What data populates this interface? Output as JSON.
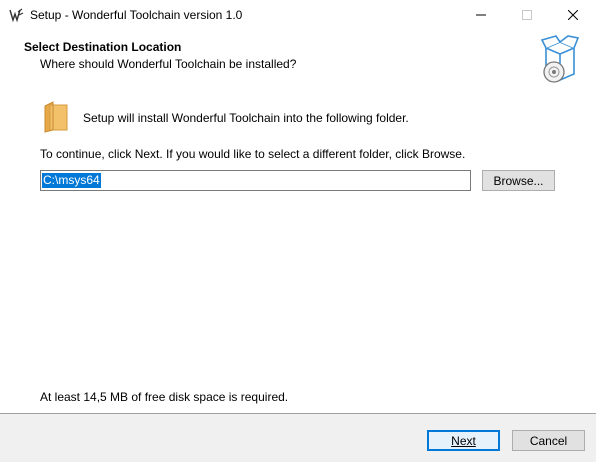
{
  "window": {
    "title": "Setup - Wonderful Toolchain version 1.0"
  },
  "header": {
    "title": "Select Destination Location",
    "subtitle": "Where should Wonderful Toolchain be installed?",
    "icon": "setup-box-disc-icon"
  },
  "main": {
    "info_text": "Setup will install Wonderful Toolchain into the following folder.",
    "continue_text": "To continue, click Next. If you would like to select a different folder, click Browse.",
    "path_value": "C:\\msys64",
    "browse_label": "Browse...",
    "disk_space_text": "At least 14,5 MB of free disk space is required."
  },
  "footer": {
    "next_label": "Next",
    "cancel_label": "Cancel"
  },
  "colors": {
    "accent": "#0078d7",
    "folder": "#f4c16b",
    "button_face": "#e1e1e1",
    "footer_bg": "#f0f0f0"
  }
}
